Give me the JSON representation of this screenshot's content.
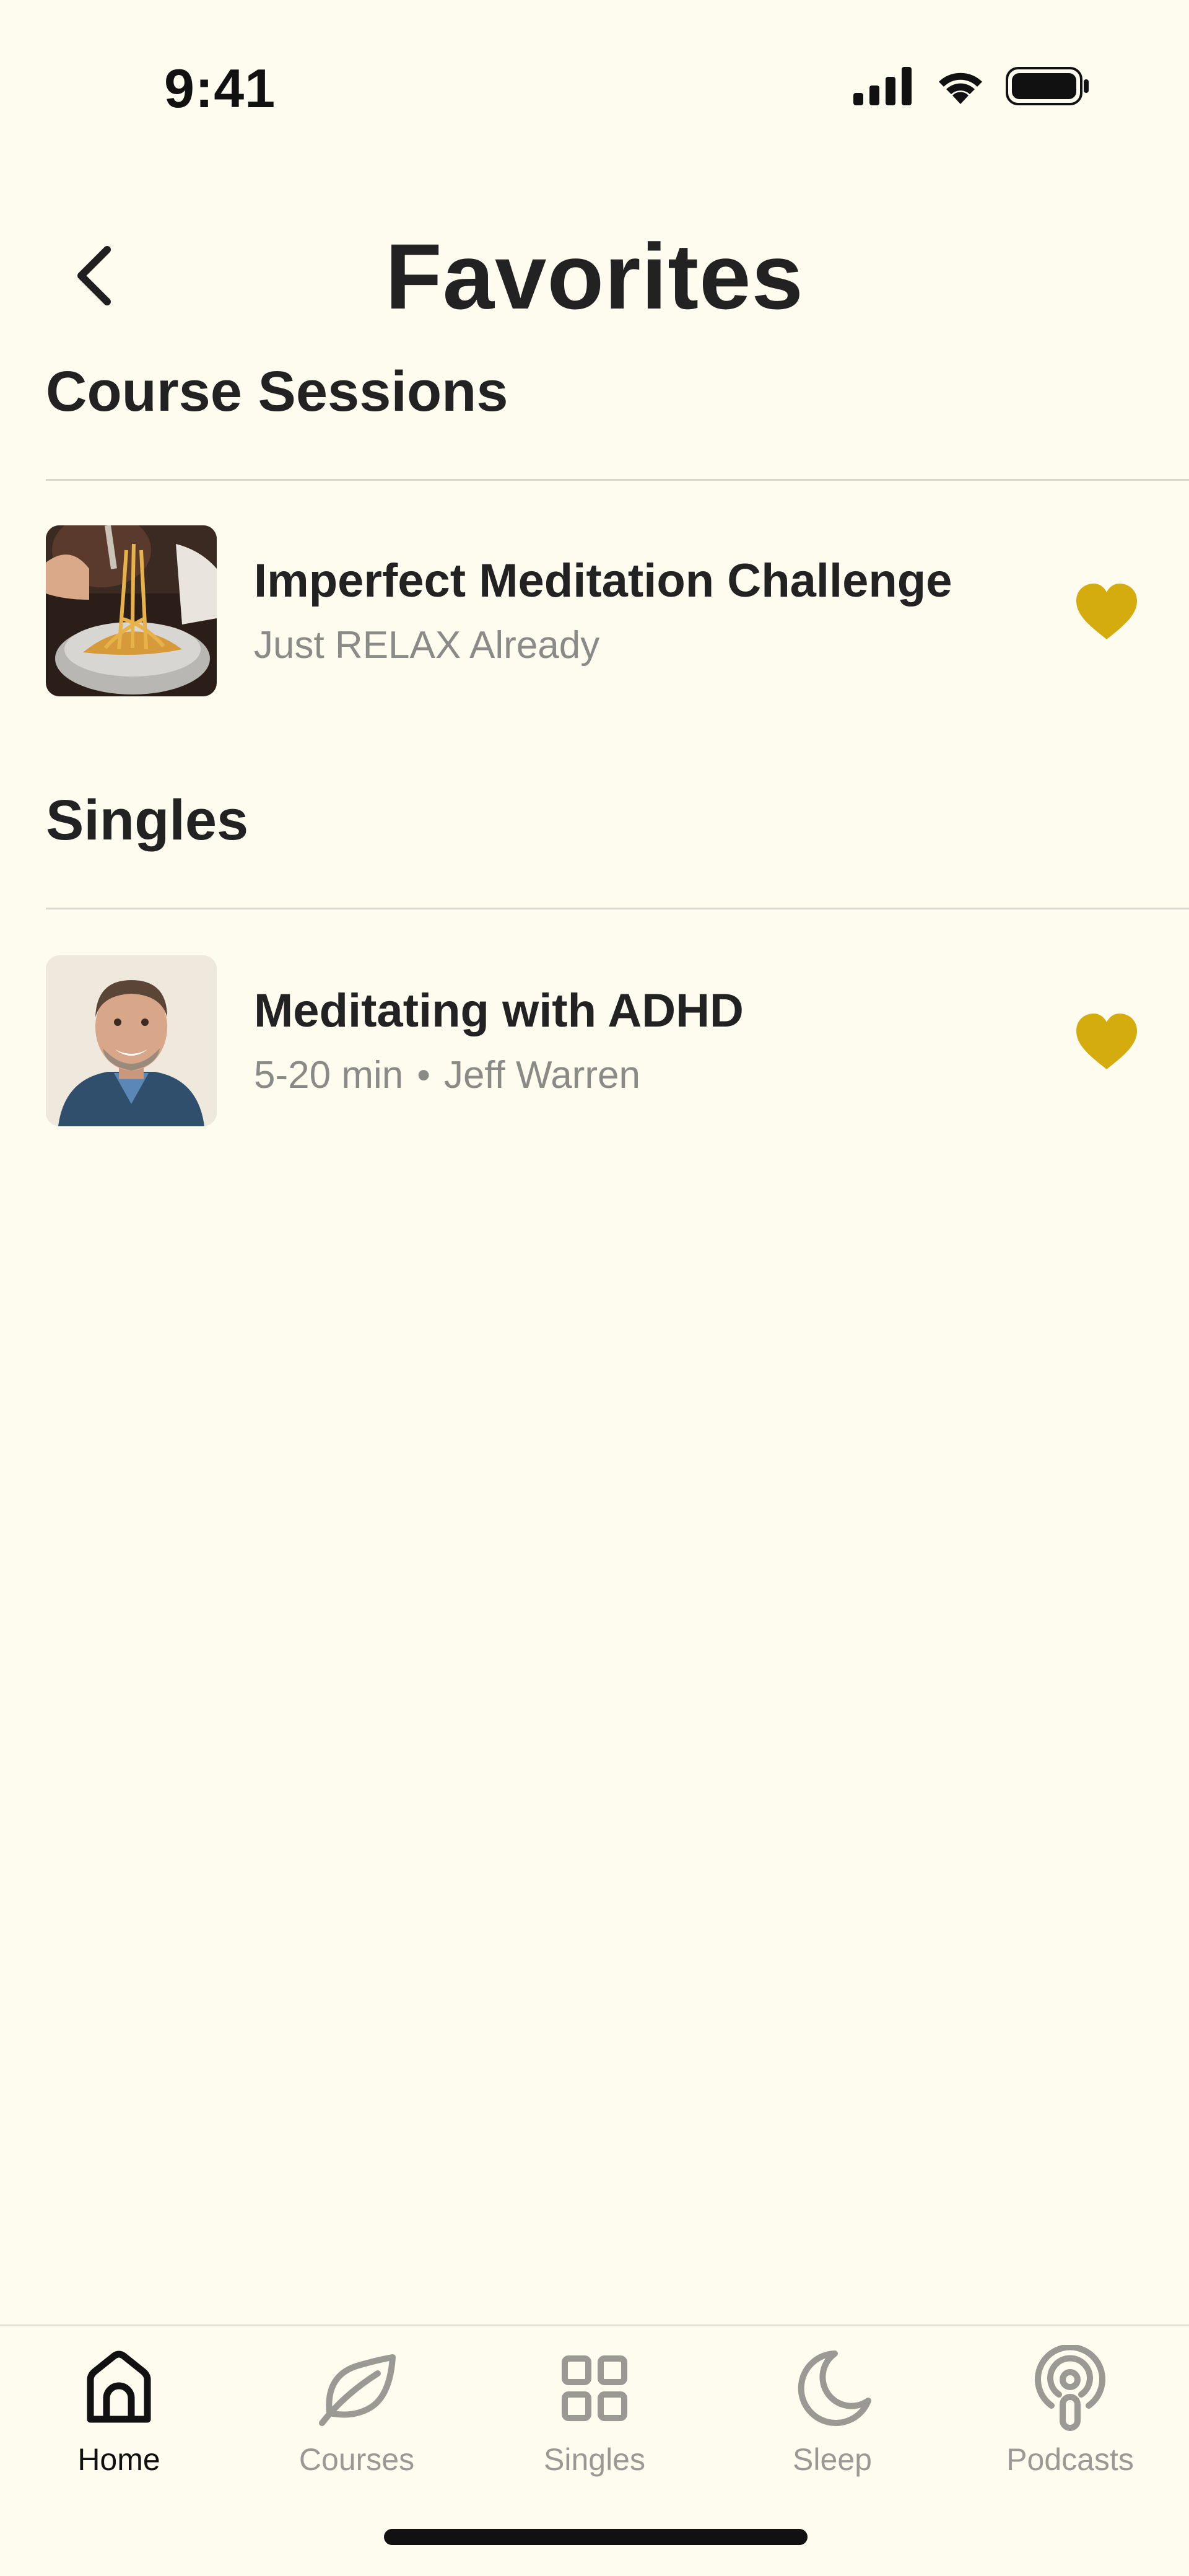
{
  "status_bar": {
    "time": "9:41"
  },
  "header": {
    "title": "Favorites"
  },
  "sections": [
    {
      "heading": "Course Sessions",
      "items": [
        {
          "title": "Imperfect Meditation Challenge",
          "subtitle": "Just RELAX Already"
        }
      ]
    },
    {
      "heading": "Singles",
      "items": [
        {
          "title": "Meditating with ADHD",
          "duration": "5-20 min",
          "separator": "•",
          "author": "Jeff Warren"
        }
      ]
    }
  ],
  "colors": {
    "accent_heart": "#d4ac0d",
    "background": "#fefbef"
  },
  "tab_bar": {
    "tabs": [
      {
        "label": "Home",
        "icon": "home-icon",
        "active": true
      },
      {
        "label": "Courses",
        "icon": "leaf-icon"
      },
      {
        "label": "Singles",
        "icon": "grid-icon"
      },
      {
        "label": "Sleep",
        "icon": "moon-icon"
      },
      {
        "label": "Podcasts",
        "icon": "podcast-icon"
      }
    ]
  }
}
